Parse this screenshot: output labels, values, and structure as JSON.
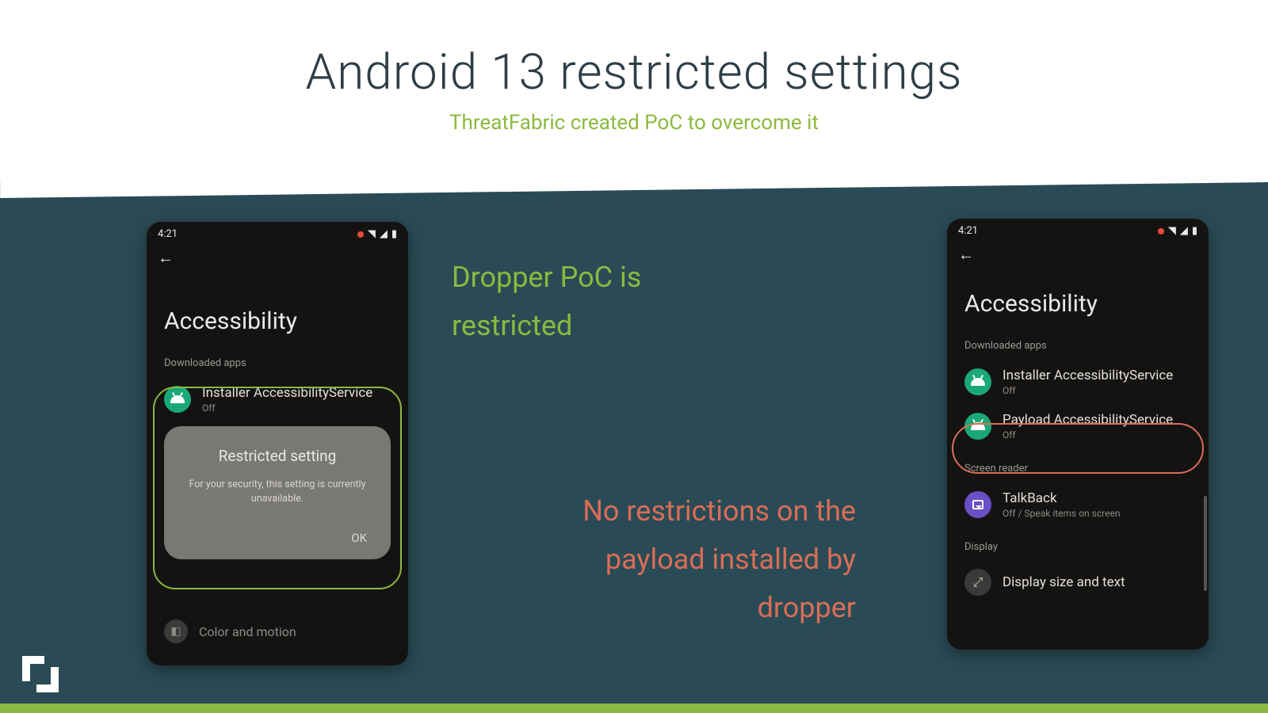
{
  "header": {
    "title": "Android 13 restricted settings",
    "subtitle": "ThreatFabric created PoC to overcome it"
  },
  "annotations": {
    "restricted": "Dropper PoC is restricted",
    "unrestricted": "No restrictions on the payload installed by dropper"
  },
  "phone_left": {
    "status_time": "4:21",
    "page_title": "Accessibility",
    "section_downloaded": "Downloaded apps",
    "app1_name": "Installer AccessibilityService",
    "app1_state": "Off",
    "dialog_title": "Restricted setting",
    "dialog_body": "For your security, this setting is currently unavailable.",
    "dialog_ok": "OK",
    "dim_row_label": "Color and motion"
  },
  "phone_right": {
    "status_time": "4:21",
    "page_title": "Accessibility",
    "section_downloaded": "Downloaded apps",
    "app1_name": "Installer AccessibilityService",
    "app1_state": "Off",
    "app2_name": "Payload AccessibilityService",
    "app2_state": "Off",
    "section_reader": "Screen reader",
    "talkback_name": "TalkBack",
    "talkback_state": "Off / Speak items on screen",
    "section_display": "Display",
    "display_row": "Display size and text"
  }
}
